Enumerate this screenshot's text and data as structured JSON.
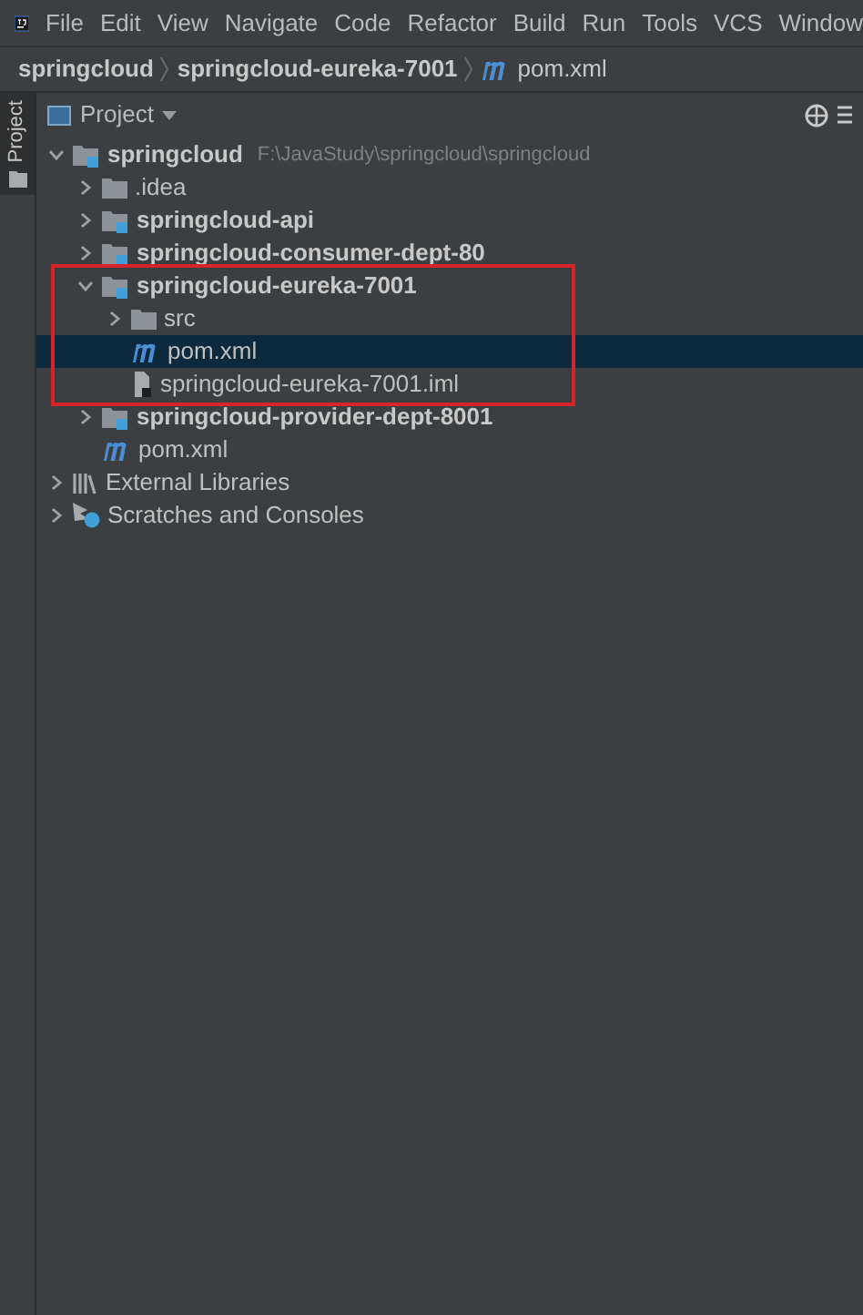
{
  "menu": [
    "File",
    "Edit",
    "View",
    "Navigate",
    "Code",
    "Refactor",
    "Build",
    "Run",
    "Tools",
    "VCS",
    "Window"
  ],
  "breadcrumbs": [
    {
      "label": "springcloud",
      "kind": "module"
    },
    {
      "label": "springcloud-eureka-7001",
      "kind": "module"
    },
    {
      "label": "pom.xml",
      "kind": "maven"
    }
  ],
  "side_tab": {
    "label": "Project",
    "selected": true
  },
  "project_header": {
    "label": "Project"
  },
  "tree": [
    {
      "label": "springcloud",
      "kind": "module",
      "hint": "F:\\JavaStudy\\springcloud\\springcloud",
      "expanded": true,
      "selected": false,
      "children": [
        {
          "label": ".idea",
          "kind": "folder",
          "expanded": false,
          "selected": false
        },
        {
          "label": "springcloud-api",
          "kind": "module",
          "expanded": false,
          "selected": false
        },
        {
          "label": "springcloud-consumer-dept-80",
          "kind": "module",
          "expanded": false,
          "selected": false
        },
        {
          "label": "springcloud-eureka-7001",
          "kind": "module",
          "expanded": true,
          "selected": false,
          "highlighted": true,
          "children": [
            {
              "label": "src",
              "kind": "folder",
              "expanded": false,
              "selected": false
            },
            {
              "label": "pom.xml",
              "kind": "maven",
              "selected": true
            },
            {
              "label": "springcloud-eureka-7001.iml",
              "kind": "iml",
              "selected": false
            }
          ]
        },
        {
          "label": "springcloud-provider-dept-8001",
          "kind": "module",
          "expanded": false,
          "selected": false
        },
        {
          "label": "pom.xml",
          "kind": "maven",
          "selected": false
        }
      ]
    },
    {
      "label": "External Libraries",
      "kind": "libraries",
      "expanded": false,
      "selected": false
    },
    {
      "label": "Scratches and Consoles",
      "kind": "scratches",
      "expanded": false,
      "selected": false
    }
  ]
}
